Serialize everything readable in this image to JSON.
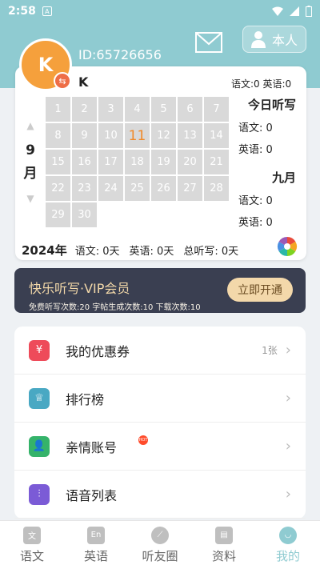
{
  "status_bar": {
    "time": "2:58",
    "notif_icon": "A"
  },
  "header": {
    "user_id": "ID:65726656",
    "switch_label": "本人"
  },
  "profile": {
    "avatar_letter": "K",
    "username": "K",
    "top_counts": "语文:0  英语:0"
  },
  "calendar": {
    "month_number": "9",
    "month_label": "月",
    "days": [
      "1",
      "2",
      "3",
      "4",
      "5",
      "6",
      "7",
      "8",
      "9",
      "10",
      "11",
      "12",
      "13",
      "14",
      "15",
      "16",
      "17",
      "18",
      "19",
      "20",
      "21",
      "22",
      "23",
      "24",
      "25",
      "26",
      "27",
      "28",
      "29",
      "30"
    ],
    "today": "11"
  },
  "side_panel": {
    "today_title": "今日听写",
    "today_chinese": "语文:   0",
    "today_english": "英语:   0",
    "month_title": "九月",
    "month_chinese": "语文:   0",
    "month_english": "英语:   0"
  },
  "bottom_stats": {
    "year": "2024年",
    "chinese": "语文:  0天",
    "english": "英语:  0天",
    "total": "总听写:  0天"
  },
  "vip": {
    "title": "快乐听写·VIP会员",
    "info": "免费听写次数:20  字帖生成次数:10  下载次数:10",
    "button": "立即开通"
  },
  "menu": {
    "coupons": {
      "label": "我的优惠券",
      "extra": "1张"
    },
    "ranking": {
      "label": "排行榜"
    },
    "family": {
      "label": "亲情账号",
      "badge": "HOT"
    },
    "audio": {
      "label": "语音列表"
    }
  },
  "tabs": [
    {
      "label": "语文",
      "icon": "文"
    },
    {
      "label": "英语",
      "icon": "En"
    },
    {
      "label": "听友圈",
      "icon": ""
    },
    {
      "label": "资料",
      "icon": ""
    },
    {
      "label": "我的",
      "icon": ""
    }
  ]
}
